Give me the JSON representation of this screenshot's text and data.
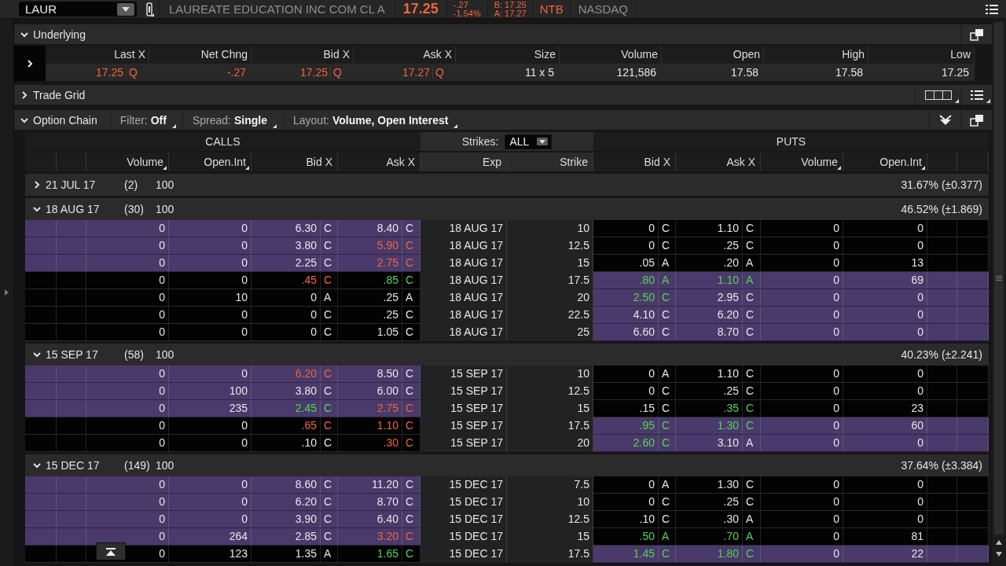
{
  "quote": {
    "symbol": "LAUR",
    "description": "LAUREATE EDUCATION INC COM CL A",
    "last": "17.25",
    "net_change": "-.27",
    "percent_change": "-1.54%",
    "bid": "B: 17.25",
    "ask": "A: 17.27",
    "down": true,
    "borrow_flag": "NTB",
    "exchange": "NASDAQ"
  },
  "underlying": {
    "title": "Underlying",
    "expanded": true,
    "columns": [
      {
        "label": "Last X",
        "value": "17.25",
        "exchange": "Q",
        "down": true
      },
      {
        "label": "Net Chng",
        "value": "-.27",
        "down": true
      },
      {
        "label": "Bid X",
        "value": "17.25",
        "exchange": "Q",
        "down": true
      },
      {
        "label": "Ask X",
        "value": "17.27",
        "exchange": "Q",
        "down": true
      },
      {
        "label": "Size",
        "value": "11 x 5"
      },
      {
        "label": "Volume",
        "value": "121,586"
      },
      {
        "label": "Open",
        "value": "17.58"
      },
      {
        "label": "High",
        "value": "17.58"
      },
      {
        "label": "Low",
        "value": "17.25"
      }
    ]
  },
  "trade_grid": {
    "title": "Trade Grid",
    "expanded": false
  },
  "option_chain": {
    "title": "Option Chain",
    "expanded": true,
    "filters": [
      {
        "label": "Filter:",
        "value": "Off"
      },
      {
        "label": "Spread:",
        "value": "Single"
      },
      {
        "label": "Layout:",
        "value": "Volume, Open Interest"
      }
    ],
    "calls_label": "CALLS",
    "puts_label": "PUTS",
    "strikes_label": "Strikes:",
    "strikes_value": "ALL",
    "call_columns": [
      {
        "label": "Volume",
        "sortable": true
      },
      {
        "label": "Open.Int",
        "sortable": true
      },
      {
        "label": "Bid X"
      },
      {
        "label": "Ask X"
      }
    ],
    "middle_columns": [
      {
        "label": "Exp"
      },
      {
        "label": "Strike"
      }
    ],
    "put_columns": [
      {
        "label": "Bid X"
      },
      {
        "label": "Ask X"
      },
      {
        "label": "Volume",
        "sortable": true
      },
      {
        "label": "Open.Int",
        "sortable": true
      }
    ],
    "groups": [
      {
        "expiry": "21 JUL 17",
        "days": "(2)",
        "multiplier": "100",
        "volatility": "31.67% (±0.377)",
        "expanded": false
      },
      {
        "expiry": "18 AUG 17",
        "days": "(30)",
        "multiplier": "100",
        "volatility": "46.52% (±1.869)",
        "expanded": true,
        "rows": [
          {
            "call_itm": true,
            "put_itm": false,
            "call": {
              "volume": "0",
              "open_int": "0",
              "bid": "6.30",
              "bid_x": "C",
              "ask": "8.40",
              "ask_x": "C"
            },
            "exp": "18 AUG 17",
            "strike": "10",
            "put": {
              "bid": "0",
              "bid_x": "C",
              "ask": "1.10",
              "ask_x": "C",
              "volume": "0",
              "open_int": "0"
            }
          },
          {
            "call_itm": true,
            "put_itm": false,
            "call": {
              "volume": "0",
              "open_int": "0",
              "bid": "3.80",
              "bid_x": "C",
              "ask": "5.90",
              "ask_x": "C",
              "ask_down": true
            },
            "exp": "18 AUG 17",
            "strike": "12.5",
            "put": {
              "bid": "0",
              "bid_x": "C",
              "ask": ".25",
              "ask_x": "C",
              "volume": "0",
              "open_int": "0"
            }
          },
          {
            "call_itm": true,
            "put_itm": false,
            "call": {
              "volume": "0",
              "open_int": "0",
              "bid": "2.25",
              "bid_x": "C",
              "ask": "2.75",
              "ask_x": "C",
              "ask_down": true
            },
            "exp": "18 AUG 17",
            "strike": "15",
            "put": {
              "bid": ".05",
              "bid_x": "A",
              "ask": ".20",
              "ask_x": "A",
              "volume": "0",
              "open_int": "13"
            }
          },
          {
            "call_itm": false,
            "put_itm": true,
            "call": {
              "volume": "0",
              "open_int": "0",
              "bid": ".45",
              "bid_x": "C",
              "bid_down": true,
              "ask": ".85",
              "ask_x": "C",
              "ask_up": true
            },
            "exp": "18 AUG 17",
            "strike": "17.5",
            "put": {
              "bid": ".80",
              "bid_x": "A",
              "bid_up": true,
              "ask": "1.10",
              "ask_x": "A",
              "ask_up": true,
              "volume": "0",
              "open_int": "69"
            }
          },
          {
            "call_itm": false,
            "put_itm": true,
            "call": {
              "volume": "0",
              "open_int": "10",
              "bid": "0",
              "bid_x": "A",
              "ask": ".25",
              "ask_x": "A"
            },
            "exp": "18 AUG 17",
            "strike": "20",
            "put": {
              "bid": "2.50",
              "bid_x": "C",
              "bid_up": true,
              "ask": "2.95",
              "ask_x": "C",
              "volume": "0",
              "open_int": "0"
            }
          },
          {
            "call_itm": false,
            "put_itm": true,
            "call": {
              "volume": "0",
              "open_int": "0",
              "bid": "0",
              "bid_x": "C",
              "ask": ".25",
              "ask_x": "C"
            },
            "exp": "18 AUG 17",
            "strike": "22.5",
            "put": {
              "bid": "4.10",
              "bid_x": "C",
              "ask": "6.20",
              "ask_x": "C",
              "volume": "0",
              "open_int": "0"
            }
          },
          {
            "call_itm": false,
            "put_itm": true,
            "call": {
              "volume": "0",
              "open_int": "0",
              "bid": "0",
              "bid_x": "C",
              "ask": "1.05",
              "ask_x": "C"
            },
            "exp": "18 AUG 17",
            "strike": "25",
            "put": {
              "bid": "6.60",
              "bid_x": "C",
              "ask": "8.70",
              "ask_x": "C",
              "volume": "0",
              "open_int": "0"
            }
          }
        ]
      },
      {
        "expiry": "15 SEP 17",
        "days": "(58)",
        "multiplier": "100",
        "volatility": "40.23% (±2.241)",
        "expanded": true,
        "rows": [
          {
            "call_itm": true,
            "put_itm": false,
            "call": {
              "volume": "0",
              "open_int": "0",
              "bid": "6.20",
              "bid_x": "C",
              "bid_down": true,
              "ask": "8.50",
              "ask_x": "C"
            },
            "exp": "15 SEP 17",
            "strike": "10",
            "put": {
              "bid": "0",
              "bid_x": "A",
              "ask": "1.10",
              "ask_x": "C",
              "volume": "0",
              "open_int": "0"
            }
          },
          {
            "call_itm": true,
            "put_itm": false,
            "call": {
              "volume": "0",
              "open_int": "100",
              "bid": "3.80",
              "bid_x": "C",
              "ask": "6.00",
              "ask_x": "C"
            },
            "exp": "15 SEP 17",
            "strike": "12.5",
            "put": {
              "bid": "0",
              "bid_x": "C",
              "ask": ".25",
              "ask_x": "C",
              "volume": "0",
              "open_int": "0"
            }
          },
          {
            "call_itm": true,
            "put_itm": false,
            "call": {
              "volume": "0",
              "open_int": "235",
              "bid": "2.45",
              "bid_x": "C",
              "bid_up": true,
              "ask": "2.75",
              "ask_x": "C",
              "ask_down": true
            },
            "exp": "15 SEP 17",
            "strike": "15",
            "put": {
              "bid": ".15",
              "bid_x": "C",
              "ask": ".35",
              "ask_x": "C",
              "ask_up": true,
              "volume": "0",
              "open_int": "23"
            }
          },
          {
            "call_itm": false,
            "put_itm": true,
            "call": {
              "volume": "0",
              "open_int": "0",
              "bid": ".65",
              "bid_x": "C",
              "bid_down": true,
              "ask": "1.10",
              "ask_x": "C",
              "ask_down": true
            },
            "exp": "15 SEP 17",
            "strike": "17.5",
            "put": {
              "bid": ".95",
              "bid_x": "C",
              "bid_up": true,
              "ask": "1.30",
              "ask_x": "C",
              "ask_up": true,
              "volume": "0",
              "open_int": "60"
            }
          },
          {
            "call_itm": false,
            "put_itm": true,
            "call": {
              "volume": "0",
              "open_int": "0",
              "bid": ".10",
              "bid_x": "C",
              "ask": ".30",
              "ask_x": "C",
              "ask_down": true
            },
            "exp": "15 SEP 17",
            "strike": "20",
            "put": {
              "bid": "2.60",
              "bid_x": "C",
              "bid_up": true,
              "ask": "3.10",
              "ask_x": "A",
              "volume": "0",
              "open_int": "0"
            }
          }
        ]
      },
      {
        "expiry": "15 DEC 17",
        "days": "(149)",
        "multiplier": "100",
        "volatility": "37.64% (±3.384)",
        "expanded": true,
        "rows": [
          {
            "call_itm": true,
            "put_itm": false,
            "call": {
              "volume": "0",
              "open_int": "0",
              "bid": "8.60",
              "bid_x": "C",
              "ask": "11.20",
              "ask_x": "C"
            },
            "exp": "15 DEC 17",
            "strike": "7.5",
            "put": {
              "bid": "0",
              "bid_x": "A",
              "ask": "1.30",
              "ask_x": "C",
              "volume": "0",
              "open_int": "0"
            }
          },
          {
            "call_itm": true,
            "put_itm": false,
            "call": {
              "volume": "0",
              "open_int": "0",
              "bid": "6.20",
              "bid_x": "C",
              "ask": "8.70",
              "ask_x": "C"
            },
            "exp": "15 DEC 17",
            "strike": "10",
            "put": {
              "bid": "0",
              "bid_x": "C",
              "ask": ".25",
              "ask_x": "C",
              "volume": "0",
              "open_int": "0"
            }
          },
          {
            "call_itm": true,
            "put_itm": false,
            "call": {
              "volume": "0",
              "open_int": "0",
              "bid": "3.90",
              "bid_x": "C",
              "ask": "6.40",
              "ask_x": "C"
            },
            "exp": "15 DEC 17",
            "strike": "12.5",
            "put": {
              "bid": ".10",
              "bid_x": "C",
              "ask": ".30",
              "ask_x": "A",
              "volume": "0",
              "open_int": "0"
            }
          },
          {
            "call_itm": true,
            "put_itm": false,
            "call": {
              "volume": "0",
              "open_int": "264",
              "bid": "2.85",
              "bid_x": "C",
              "ask": "3.20",
              "ask_x": "C",
              "ask_down": true
            },
            "exp": "15 DEC 17",
            "strike": "15",
            "put": {
              "bid": ".50",
              "bid_x": "A",
              "bid_up": true,
              "ask": ".70",
              "ask_x": "A",
              "ask_up": true,
              "volume": "0",
              "open_int": "81"
            }
          },
          {
            "call_itm": false,
            "put_itm": true,
            "call": {
              "volume": "0",
              "open_int": "123",
              "bid": "1.35",
              "bid_x": "A",
              "ask": "1.65",
              "ask_x": "C",
              "ask_up": true
            },
            "exp": "15 DEC 17",
            "strike": "17.5",
            "put": {
              "bid": "1.45",
              "bid_x": "C",
              "bid_up": true,
              "ask": "1.80",
              "ask_x": "C",
              "ask_up": true,
              "volume": "0",
              "open_int": "22"
            }
          }
        ]
      }
    ]
  }
}
